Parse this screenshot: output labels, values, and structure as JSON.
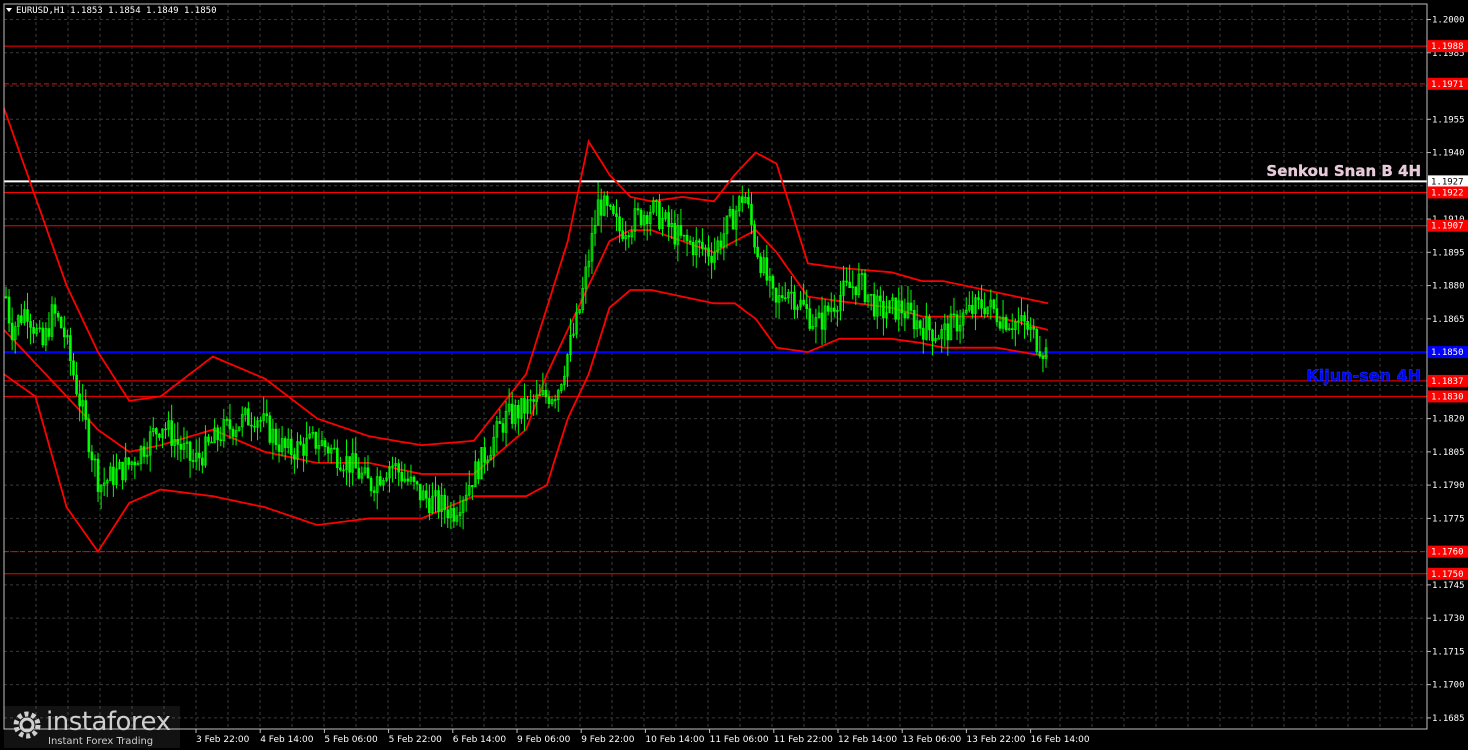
{
  "header": {
    "symbol_text": "EURUSD,H1  1.1853 1.1854 1.1849 1.1850"
  },
  "colors": {
    "background": "#000000",
    "grid": "#3a3a3a",
    "candles": "#00ff00",
    "bands": "#ff0000",
    "levels": "#ff0000",
    "kijun": "#0000ff",
    "senkou": "#ffffff",
    "label_text": "#ffffff",
    "axis_text": "#ffffff"
  },
  "annotations": {
    "senkou": "Senkou Snan B 4H",
    "kijun": "Kijun-sen 4H"
  },
  "logo": {
    "brand": "instaforex",
    "tagline": "Instant Forex Trading",
    "icon": "gear-logo-icon"
  },
  "chart_data": {
    "type": "candlestick",
    "y_range": [
      1.168,
      1.2007
    ],
    "y_ticks": [
      "1.2000",
      "1.1985",
      "1.1955",
      "1.1940",
      "1.1910",
      "1.1895",
      "1.1880",
      "1.1865",
      "1.1820",
      "1.1805",
      "1.1790",
      "1.1775",
      "1.1745",
      "1.1730",
      "1.1715",
      "1.1700",
      "1.1685"
    ],
    "x_ticks": [
      "3 Feb 22:00",
      "4 Feb 14:00",
      "5 Feb 06:00",
      "5 Feb 22:00",
      "6 Feb 14:00",
      "9 Feb 06:00",
      "9 Feb 22:00",
      "10 Feb 14:00",
      "11 Feb 06:00",
      "11 Feb 22:00",
      "12 Feb 14:00",
      "13 Feb 06:00",
      "13 Feb 22:00",
      "16 Feb 14:00"
    ],
    "horizontal_levels": [
      {
        "value": 1.1988,
        "label": "1.1988",
        "color": "#ff0000",
        "style": "solid"
      },
      {
        "value": 1.1971,
        "label": "1.1971",
        "color": "#ff0000",
        "style": "dashed"
      },
      {
        "value": 1.1927,
        "label": "1.1927",
        "color": "#ffffff",
        "style": "solid"
      },
      {
        "value": 1.1922,
        "label": "1.1922",
        "color": "#ff0000",
        "style": "solid"
      },
      {
        "value": 1.1907,
        "label": "1.1907",
        "color": "#ff0000",
        "style": "solid"
      },
      {
        "value": 1.185,
        "label": "1.1850",
        "color": "#0000ff",
        "style": "solid"
      },
      {
        "value": 1.1837,
        "label": "1.1837",
        "color": "#ff0000",
        "style": "solid"
      },
      {
        "value": 1.183,
        "label": "1.1830",
        "color": "#ff0000",
        "style": "solid"
      },
      {
        "value": 1.176,
        "label": "1.1760",
        "color": "#ff0000",
        "style": "dashed"
      },
      {
        "value": 1.175,
        "label": "1.1750",
        "color": "#ff0000",
        "style": "solid"
      }
    ],
    "price_path": {
      "t": [
        0,
        0.005,
        0.02,
        0.035,
        0.045,
        0.055,
        0.07,
        0.09,
        0.12,
        0.15,
        0.18,
        0.21,
        0.24,
        0.27,
        0.3,
        0.33,
        0.35,
        0.37,
        0.4,
        0.43,
        0.45,
        0.48,
        0.5,
        0.53,
        0.55,
        0.57,
        0.59,
        0.62,
        0.65,
        0.68,
        0.7,
        0.71,
        0.72,
        0.74,
        0.75,
        0.78,
        0.8,
        0.82,
        0.84,
        0.86,
        0.88,
        0.9,
        0.92,
        0.94,
        0.96,
        0.98,
        1.0
      ],
      "close": [
        1.1875,
        1.186,
        1.187,
        1.1852,
        1.1868,
        1.186,
        1.183,
        1.179,
        1.18,
        1.1818,
        1.18,
        1.1815,
        1.1822,
        1.1805,
        1.181,
        1.18,
        1.179,
        1.18,
        1.1785,
        1.1778,
        1.1795,
        1.182,
        1.1825,
        1.1833,
        1.1865,
        1.1918,
        1.1905,
        1.1915,
        1.19,
        1.1895,
        1.1912,
        1.1922,
        1.19,
        1.187,
        1.188,
        1.1862,
        1.1875,
        1.1882,
        1.1868,
        1.187,
        1.1862,
        1.1858,
        1.1866,
        1.1872,
        1.1865,
        1.1862,
        1.185
      ]
    },
    "bands": {
      "t": [
        0,
        0.03,
        0.06,
        0.09,
        0.12,
        0.15,
        0.2,
        0.25,
        0.3,
        0.35,
        0.4,
        0.45,
        0.5,
        0.52,
        0.54,
        0.56,
        0.58,
        0.6,
        0.62,
        0.65,
        0.68,
        0.7,
        0.72,
        0.74,
        0.77,
        0.8,
        0.85,
        0.88,
        0.9,
        0.95,
        1.0
      ],
      "upper": [
        1.196,
        1.192,
        1.188,
        1.185,
        1.1828,
        1.183,
        1.1848,
        1.1838,
        1.182,
        1.1812,
        1.1808,
        1.181,
        1.184,
        1.187,
        1.19,
        1.1945,
        1.193,
        1.192,
        1.1918,
        1.192,
        1.1918,
        1.193,
        1.194,
        1.1935,
        1.189,
        1.1888,
        1.1886,
        1.1882,
        1.1882,
        1.1877,
        1.1872
      ],
      "middle": [
        1.186,
        1.1845,
        1.183,
        1.1815,
        1.1805,
        1.1808,
        1.1815,
        1.1805,
        1.18,
        1.18,
        1.1795,
        1.1795,
        1.1815,
        1.184,
        1.186,
        1.188,
        1.19,
        1.1905,
        1.1905,
        1.19,
        1.1895,
        1.19,
        1.1905,
        1.1895,
        1.1875,
        1.1873,
        1.187,
        1.1866,
        1.1866,
        1.1866,
        1.186
      ],
      "lower": [
        1.184,
        1.183,
        1.178,
        1.176,
        1.1782,
        1.1788,
        1.1785,
        1.178,
        1.1772,
        1.1775,
        1.1775,
        1.1785,
        1.1785,
        1.179,
        1.182,
        1.184,
        1.187,
        1.1878,
        1.1878,
        1.1875,
        1.1872,
        1.1872,
        1.1865,
        1.1852,
        1.185,
        1.1856,
        1.1856,
        1.1854,
        1.1852,
        1.1852,
        1.1848
      ]
    }
  }
}
